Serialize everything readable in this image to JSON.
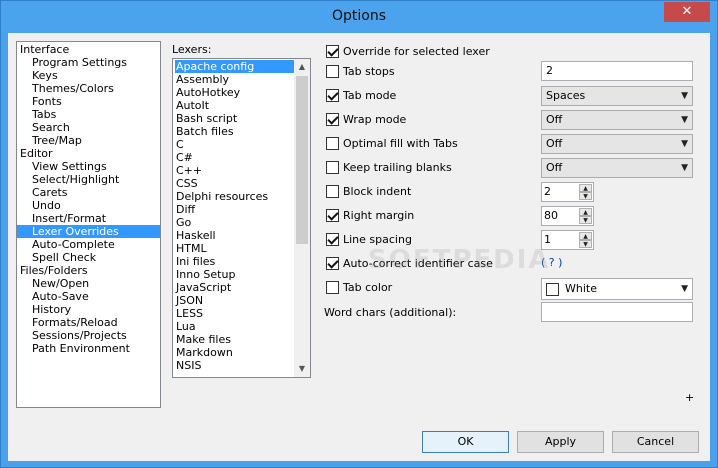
{
  "window": {
    "title": "Options",
    "close_label": "✕"
  },
  "tree": {
    "items": [
      {
        "label": "Interface",
        "child": false,
        "selected": false
      },
      {
        "label": "Program Settings",
        "child": true,
        "selected": false
      },
      {
        "label": "Keys",
        "child": true,
        "selected": false
      },
      {
        "label": "Themes/Colors",
        "child": true,
        "selected": false
      },
      {
        "label": "Fonts",
        "child": true,
        "selected": false
      },
      {
        "label": "Tabs",
        "child": true,
        "selected": false
      },
      {
        "label": "Search",
        "child": true,
        "selected": false
      },
      {
        "label": "Tree/Map",
        "child": true,
        "selected": false
      },
      {
        "label": "Editor",
        "child": false,
        "selected": false
      },
      {
        "label": "View Settings",
        "child": true,
        "selected": false
      },
      {
        "label": "Select/Highlight",
        "child": true,
        "selected": false
      },
      {
        "label": "Carets",
        "child": true,
        "selected": false
      },
      {
        "label": "Undo",
        "child": true,
        "selected": false
      },
      {
        "label": "Insert/Format",
        "child": true,
        "selected": false
      },
      {
        "label": "Lexer Overrides",
        "child": true,
        "selected": true
      },
      {
        "label": "Auto-Complete",
        "child": true,
        "selected": false
      },
      {
        "label": "Spell Check",
        "child": true,
        "selected": false
      },
      {
        "label": "Files/Folders",
        "child": false,
        "selected": false
      },
      {
        "label": "New/Open",
        "child": true,
        "selected": false
      },
      {
        "label": "Auto-Save",
        "child": true,
        "selected": false
      },
      {
        "label": "History",
        "child": true,
        "selected": false
      },
      {
        "label": "Formats/Reload",
        "child": true,
        "selected": false
      },
      {
        "label": "Sessions/Projects",
        "child": true,
        "selected": false
      },
      {
        "label": "Path Environment",
        "child": true,
        "selected": false
      }
    ]
  },
  "lexers": {
    "label": "Lexers:",
    "items": [
      "Apache config",
      "Assembly",
      "AutoHotkey",
      "AutoIt",
      "Bash script",
      "Batch files",
      "C",
      "C#",
      "C++",
      "CSS",
      "Delphi resources",
      "Diff",
      "Go",
      "Haskell",
      "HTML",
      "Ini files",
      "Inno Setup",
      "JavaScript",
      "JSON",
      "LESS",
      "Lua",
      "Make files",
      "Markdown",
      "NSIS"
    ],
    "selected_index": 0
  },
  "options": {
    "override": {
      "label": "Override for selected lexer",
      "checked": true
    },
    "tab_stops": {
      "label": "Tab stops",
      "checked": false,
      "value": "2"
    },
    "tab_mode": {
      "label": "Tab mode",
      "checked": true,
      "value": "Spaces"
    },
    "wrap_mode": {
      "label": "Wrap mode",
      "checked": true,
      "value": "Off"
    },
    "optimal_fill": {
      "label": "Optimal fill with Tabs",
      "checked": false,
      "value": "Off"
    },
    "keep_trailing": {
      "label": "Keep trailing blanks",
      "checked": false,
      "value": "Off"
    },
    "block_indent": {
      "label": "Block indent",
      "checked": false,
      "value": "2"
    },
    "right_margin": {
      "label": "Right margin",
      "checked": true,
      "value": "80"
    },
    "line_spacing": {
      "label": "Line spacing",
      "checked": true,
      "value": "1"
    },
    "autocorrect": {
      "label": "Auto-correct identifier case",
      "checked": true,
      "link": "( ? )"
    },
    "tab_color": {
      "label": "Tab color",
      "checked": false,
      "value": "White"
    },
    "word_chars": {
      "label": "Word chars (additional):",
      "value": ""
    }
  },
  "plus_label": "+",
  "buttons": {
    "ok": "OK",
    "apply": "Apply",
    "cancel": "Cancel"
  },
  "watermark": "SOFTPEDIA"
}
